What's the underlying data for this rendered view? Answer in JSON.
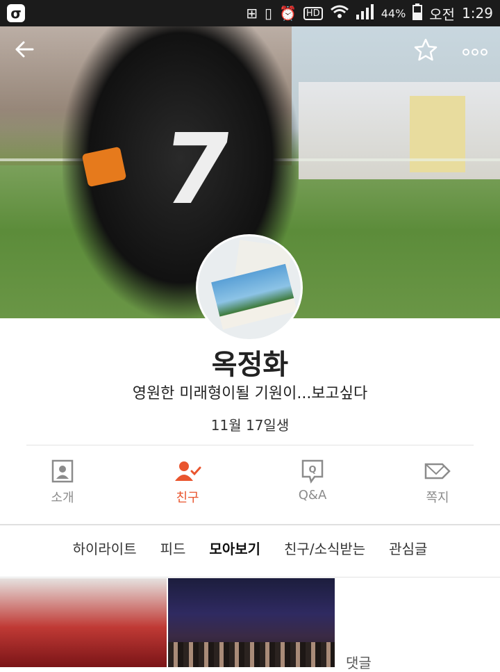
{
  "statusbar": {
    "battery": "44%",
    "ampm": "오전",
    "time": "1:29",
    "hd": "HD"
  },
  "profile": {
    "name": "옥정화",
    "status": "영원한 미래형이될 기원이...보고싶다",
    "birthday": "11월 17일생"
  },
  "tabs": [
    {
      "label": "소개",
      "active": false
    },
    {
      "label": "친구",
      "active": true
    },
    {
      "label": "Q&A",
      "active": false
    },
    {
      "label": "쪽지",
      "active": false
    }
  ],
  "subtabs": [
    {
      "label": "하이라이트"
    },
    {
      "label": "피드"
    },
    {
      "label": "모아보기"
    },
    {
      "label": "친구/소식받는"
    },
    {
      "label": "관심글"
    }
  ],
  "feed": {
    "comment_label": "댓글"
  },
  "colors": {
    "accent": "#e9552e",
    "tab_inactive": "#8b8b8b"
  }
}
